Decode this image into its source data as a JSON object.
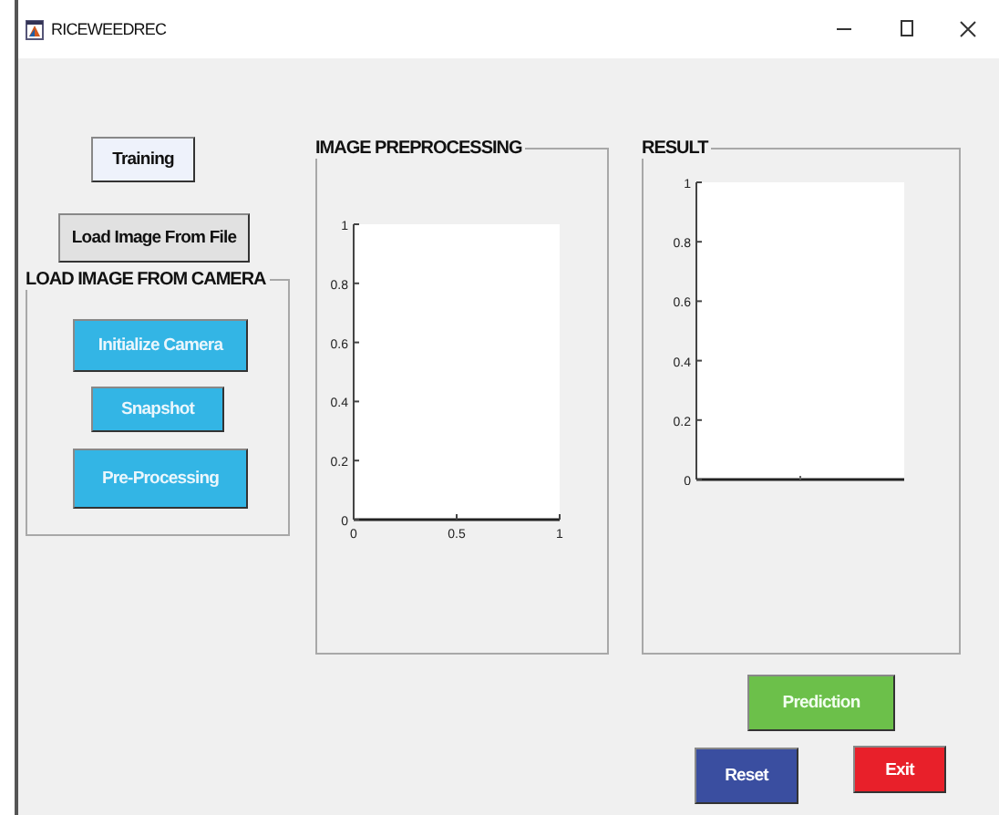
{
  "window": {
    "title": "RICEWEEDREC"
  },
  "left_buttons": [
    {
      "label": "Training",
      "kind": "plain"
    },
    {
      "label": "Load Image From File",
      "kind": "grey"
    }
  ],
  "camera_panel": {
    "title": "LOAD IMAGE FROM CAMERA",
    "buttons": [
      {
        "label": "Initialize Camera"
      },
      {
        "label": "Snapshot"
      },
      {
        "label": "Pre-Processing"
      }
    ]
  },
  "preprocessing_panel": {
    "title": "IMAGE PREPROCESSING",
    "chart_data": {
      "type": "line",
      "xlim": [
        0,
        1
      ],
      "ylim": [
        0,
        1
      ],
      "xticks": [
        {
          "value": 0,
          "label": "0"
        },
        {
          "value": 0.5,
          "label": "0.5"
        },
        {
          "value": 1,
          "label": "1"
        }
      ],
      "yticks": [
        {
          "value": 0,
          "label": "0"
        },
        {
          "value": 0.2,
          "label": "0.2"
        },
        {
          "value": 0.4,
          "label": "0.4"
        },
        {
          "value": 0.6,
          "label": "0.6"
        },
        {
          "value": 0.8,
          "label": "0.8"
        },
        {
          "value": 1,
          "label": "1"
        }
      ]
    }
  },
  "result_panel": {
    "title": "RESULT",
    "chart_data": {
      "type": "line",
      "categories": [
        null
      ],
      "ylim": [
        0,
        1
      ],
      "yticks": [
        {
          "value": 0,
          "label": "0"
        },
        {
          "value": 0.2,
          "label": "0.2"
        },
        {
          "value": 0.4,
          "label": "0.4"
        },
        {
          "value": 0.6,
          "label": "0.6"
        },
        {
          "value": 0.8,
          "label": "0.8"
        },
        {
          "value": 1,
          "label": "1"
        }
      ]
    }
  },
  "action_buttons": [
    {
      "label": "Prediction",
      "color": "#6cc04a"
    },
    {
      "label": "Reset",
      "color": "#3a4ea0"
    },
    {
      "label": "Exit",
      "color": "#e8202a"
    }
  ]
}
